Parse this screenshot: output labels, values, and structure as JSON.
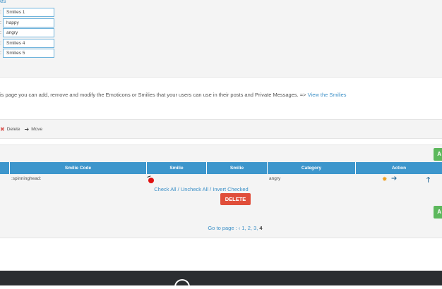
{
  "categories": {
    "heading": "es",
    "inputs": [
      "Smilies 1",
      "happy",
      "angry",
      "Smilies 4",
      "Smilies 5"
    ]
  },
  "description": {
    "text": "is page you can add, remove and modify the Emoticons or Smilies that your users can use in their posts and Private Messages. =>",
    "link": "View the Smilies"
  },
  "legend": {
    "delete_label": "Delete",
    "move_label": "Move"
  },
  "table": {
    "add_label": "A",
    "headers": [
      "Smilie Code",
      "Smilie",
      "Smilie",
      "Category",
      "Action"
    ],
    "rows": [
      {
        "code": ":spinninghead:",
        "category": "angry"
      }
    ],
    "check_all": "Check All",
    "uncheck_all": "Uncheck All",
    "invert_checked": "Invert Checked",
    "separator": "/",
    "delete_label": "DELETE"
  },
  "pagination": {
    "label": "Go to page :",
    "prev": "‹",
    "pages": [
      "1",
      "2",
      "3"
    ],
    "current": "4"
  },
  "colors": {
    "accent": "#3d96cc",
    "danger": "#e04e3a",
    "success": "#5cb85c",
    "footer": "#2b2e31"
  },
  "icons": [
    "delete-icon",
    "move-arrow-icon",
    "gear-icon",
    "arrow-right-icon",
    "arrow-up-icon",
    "cloud-icon"
  ]
}
